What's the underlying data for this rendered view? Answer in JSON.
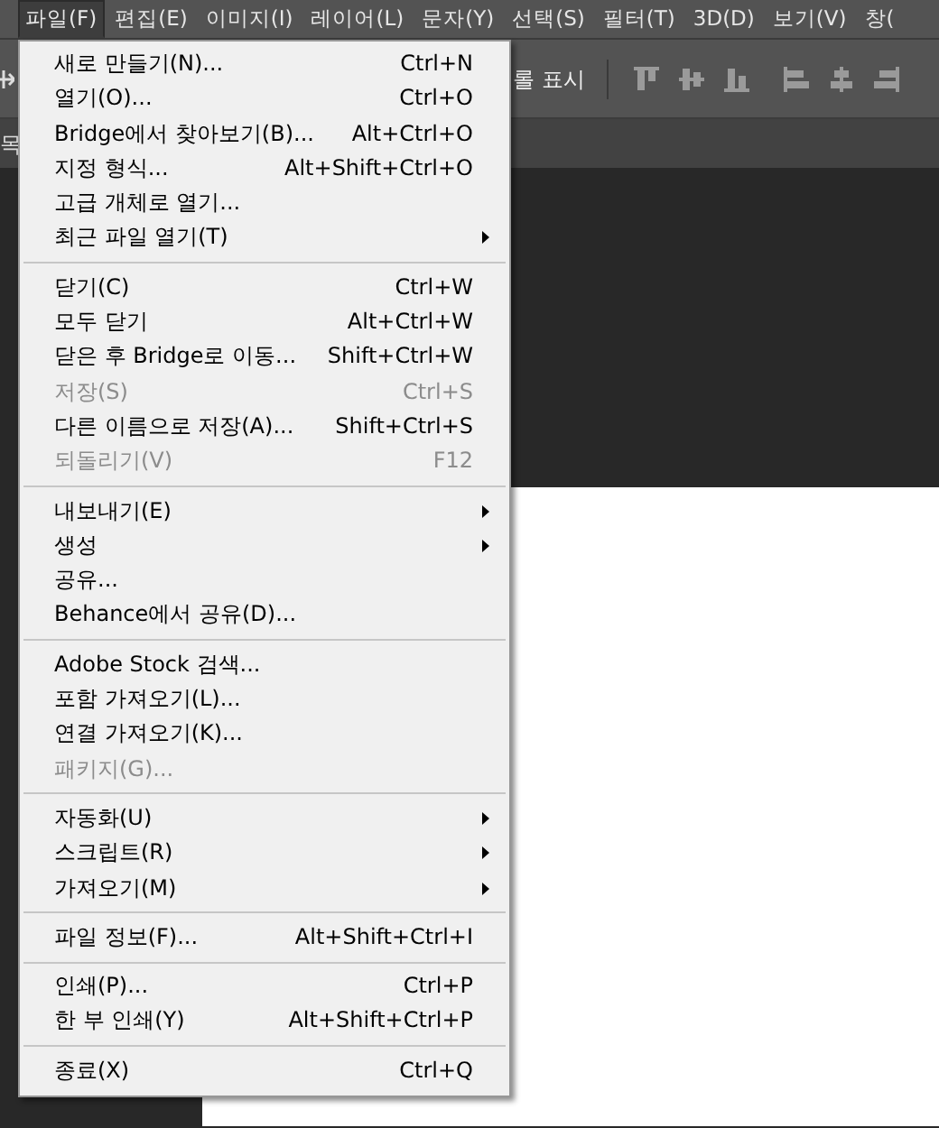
{
  "menubar": [
    {
      "label": "파일(F)",
      "selected": true
    },
    {
      "label": "편집(E)",
      "selected": false
    },
    {
      "label": "이미지(I)",
      "selected": false
    },
    {
      "label": "레이어(L)",
      "selected": false
    },
    {
      "label": "문자(Y)",
      "selected": false
    },
    {
      "label": "선택(S)",
      "selected": false
    },
    {
      "label": "필터(T)",
      "selected": false
    },
    {
      "label": "3D(D)",
      "selected": false
    },
    {
      "label": "보기(V)",
      "selected": false
    },
    {
      "label": "창(",
      "selected": false
    }
  ],
  "toolbar": {
    "show_controls_label": "롤 표시"
  },
  "tab_bar": {
    "label": "목"
  },
  "file_menu": [
    {
      "kind": "item",
      "label": "새로 만들기(N)...",
      "shortcut": "Ctrl+N",
      "disabled": false,
      "submenu": false
    },
    {
      "kind": "item",
      "label": "열기(O)...",
      "shortcut": "Ctrl+O",
      "disabled": false,
      "submenu": false
    },
    {
      "kind": "item",
      "label": "Bridge에서 찾아보기(B)...",
      "shortcut": "Alt+Ctrl+O",
      "disabled": false,
      "submenu": false
    },
    {
      "kind": "item",
      "label": "지정 형식...",
      "shortcut": "Alt+Shift+Ctrl+O",
      "disabled": false,
      "submenu": false
    },
    {
      "kind": "item",
      "label": "고급 개체로 열기...",
      "disabled": false,
      "submenu": false
    },
    {
      "kind": "item",
      "label": "최근 파일 열기(T)",
      "disabled": false,
      "submenu": true
    },
    {
      "kind": "separator"
    },
    {
      "kind": "item",
      "label": "닫기(C)",
      "shortcut": "Ctrl+W",
      "disabled": false,
      "submenu": false
    },
    {
      "kind": "item",
      "label": "모두 닫기",
      "shortcut": "Alt+Ctrl+W",
      "disabled": false,
      "submenu": false
    },
    {
      "kind": "item",
      "label": "닫은 후 Bridge로 이동...",
      "shortcut": "Shift+Ctrl+W",
      "disabled": false,
      "submenu": false
    },
    {
      "kind": "item",
      "label": "저장(S)",
      "shortcut": "Ctrl+S",
      "disabled": true,
      "submenu": false
    },
    {
      "kind": "item",
      "label": "다른 이름으로 저장(A)...",
      "shortcut": "Shift+Ctrl+S",
      "disabled": false,
      "submenu": false
    },
    {
      "kind": "item",
      "label": "되돌리기(V)",
      "shortcut": "F12",
      "disabled": true,
      "submenu": false
    },
    {
      "kind": "separator"
    },
    {
      "kind": "item",
      "label": "내보내기(E)",
      "disabled": false,
      "submenu": true
    },
    {
      "kind": "item",
      "label": "생성",
      "disabled": false,
      "submenu": true
    },
    {
      "kind": "item",
      "label": "공유...",
      "disabled": false,
      "submenu": false
    },
    {
      "kind": "item",
      "label": "Behance에서 공유(D)...",
      "disabled": false,
      "submenu": false
    },
    {
      "kind": "separator"
    },
    {
      "kind": "item",
      "label": "Adobe Stock 검색...",
      "disabled": false,
      "submenu": false
    },
    {
      "kind": "item",
      "label": "포함 가져오기(L)...",
      "disabled": false,
      "submenu": false
    },
    {
      "kind": "item",
      "label": "연결 가져오기(K)...",
      "disabled": false,
      "submenu": false
    },
    {
      "kind": "item",
      "label": "패키지(G)...",
      "disabled": true,
      "submenu": false
    },
    {
      "kind": "separator"
    },
    {
      "kind": "item",
      "label": "자동화(U)",
      "disabled": false,
      "submenu": true
    },
    {
      "kind": "item",
      "label": "스크립트(R)",
      "disabled": false,
      "submenu": true
    },
    {
      "kind": "item",
      "label": "가져오기(M)",
      "disabled": false,
      "submenu": true
    },
    {
      "kind": "separator"
    },
    {
      "kind": "item",
      "label": "파일 정보(F)...",
      "shortcut": "Alt+Shift+Ctrl+I",
      "disabled": false,
      "submenu": false
    },
    {
      "kind": "separator"
    },
    {
      "kind": "item",
      "label": "인쇄(P)...",
      "shortcut": "Ctrl+P",
      "disabled": false,
      "submenu": false
    },
    {
      "kind": "item",
      "label": "한 부 인쇄(Y)",
      "shortcut": "Alt+Shift+Ctrl+P",
      "disabled": false,
      "submenu": false
    },
    {
      "kind": "separator"
    },
    {
      "kind": "item",
      "label": "종료(X)",
      "shortcut": "Ctrl+Q",
      "disabled": false,
      "submenu": false
    }
  ]
}
